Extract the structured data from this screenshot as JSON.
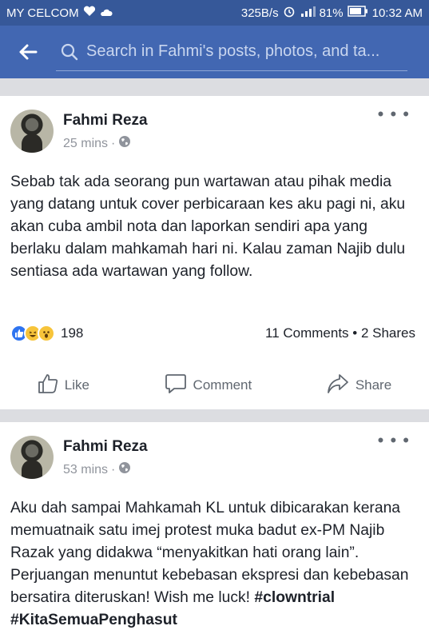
{
  "status_bar": {
    "carrier": "MY CELCOM",
    "speed": "325B/s",
    "battery": "81%",
    "time": "10:32 AM"
  },
  "search": {
    "placeholder": "Search in Fahmi's posts, photos, and ta..."
  },
  "posts": [
    {
      "author": "Fahmi Reza",
      "time": "25 mins",
      "separator": "·",
      "text": "Sebab tak ada seorang pun wartawan atau pihak media yang datang untuk cover perbicaraan kes aku pagi ni, aku akan cuba ambil nota dan laporkan sendiri apa yang berlaku dalam mahkamah hari ni. Kalau zaman Najib dulu sentiasa ada wartawan yang follow.",
      "reactions": [
        "like-icon",
        "laugh-icon",
        "wow-icon"
      ],
      "reaction_count": "198",
      "counts": "11 Comments • 2 Shares",
      "actions": {
        "like": "Like",
        "comment": "Comment",
        "share": "Share"
      }
    },
    {
      "author": "Fahmi Reza",
      "time": "53 mins",
      "separator": "·",
      "text": "Aku dah sampai Mahkamah KL untuk dibicarakan kerana memuatnaik satu imej protest muka badut ex-PM Najib Razak yang didakwa “menyakitkan hati orang lain”. Perjuangan menuntut kebebasan ekspresi dan kebebasan bersatira diteruskan! Wish me luck!",
      "hashtags": [
        "#clowntrial",
        "#KitaSemuaPenghasut"
      ]
    }
  ],
  "colors": {
    "header": "#4267b2",
    "status_bar": "#365899",
    "like_blue": "#2e74f0",
    "text": "#1d2129",
    "muted": "#90949c"
  }
}
